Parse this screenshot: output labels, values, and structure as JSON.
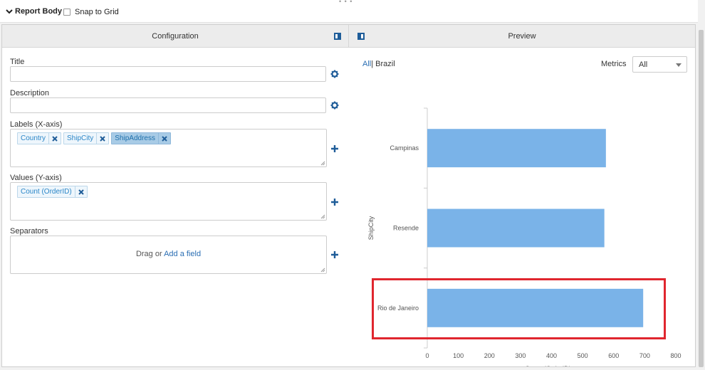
{
  "topbar": {
    "report_body_label": "Report Body",
    "snap_label": "Snap to Grid"
  },
  "panels": {
    "config_title": "Configuration",
    "preview_title": "Preview"
  },
  "form": {
    "title_label": "Title",
    "title_value": "",
    "description_label": "Description",
    "description_value": "",
    "labels_label": "Labels (X-axis)",
    "labels_chips": [
      {
        "label": "Country",
        "active": false
      },
      {
        "label": "ShipCity",
        "active": false
      },
      {
        "label": "ShipAddress",
        "active": true
      }
    ],
    "values_label": "Values (Y-axis)",
    "values_chips": [
      {
        "label": "Count (OrderID)",
        "active": false
      }
    ],
    "separators_label": "Separators",
    "drag_text": "Drag or ",
    "add_field_text": "Add a field"
  },
  "preview": {
    "crumb_all": "All",
    "crumb_sep": "|",
    "crumb_current": " Brazil",
    "metrics_label": "Metrics",
    "metrics_value": "All"
  },
  "colors": {
    "bar": "#7ab3e8",
    "highlight": "#e0262e",
    "accent": "#2a6eb3"
  },
  "chart_data": {
    "type": "bar",
    "orientation": "horizontal",
    "categories": [
      "Campinas",
      "Resende",
      "Rio de Janeiro"
    ],
    "values": [
      575,
      570,
      695
    ],
    "xlabel": "Count (OrderID)",
    "ylabel": "ShipCity",
    "xlim": [
      0,
      800
    ],
    "xticks": [
      0,
      100,
      200,
      300,
      400,
      500,
      600,
      700,
      800
    ],
    "highlighted_category": "Rio de Janeiro",
    "grid": false
  }
}
